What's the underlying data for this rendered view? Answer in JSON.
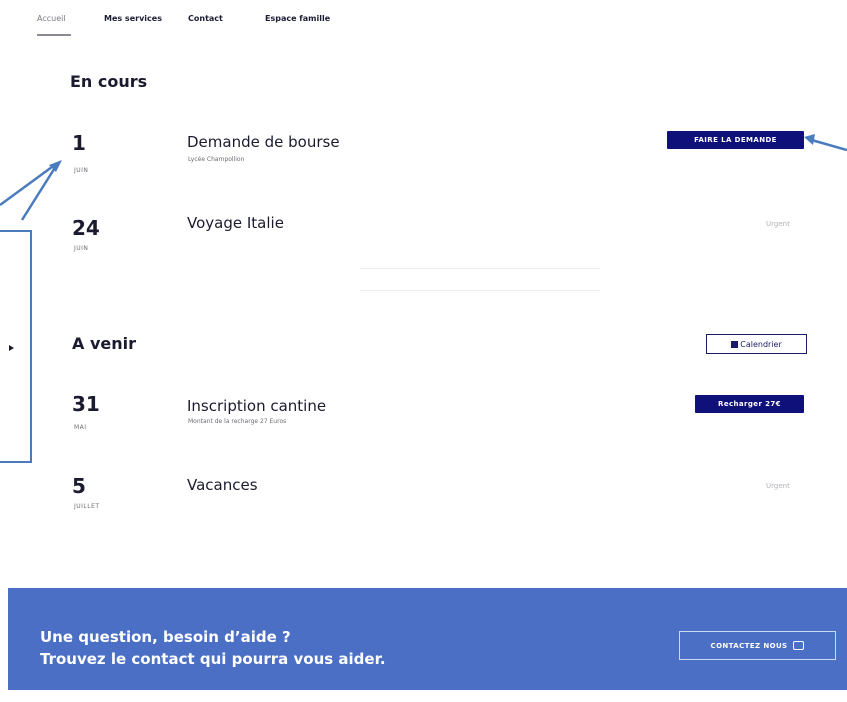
{
  "nav": {
    "items": [
      {
        "label": "Accueil"
      },
      {
        "label": "Mes services"
      },
      {
        "label": "Contact"
      },
      {
        "label": "Espace famille"
      }
    ]
  },
  "en_cours": {
    "title": "En cours",
    "events": [
      {
        "day": "1",
        "month": "JUIN",
        "title": "Demande de bourse",
        "subtitle": "Lycée Champollion",
        "action_label": "FAIRE LA DEMANDE"
      },
      {
        "day": "24",
        "month": "JUIN",
        "title": "Voyage Italie",
        "status": "Urgent"
      }
    ]
  },
  "a_venir": {
    "title": "A venir",
    "calendar_button": "Calendrier",
    "events": [
      {
        "day": "31",
        "month": "MAI",
        "title": "Inscription cantine",
        "subtitle": "Montant de la recharge 27 Euros",
        "action_label": "Recharger 27€"
      },
      {
        "day": "5",
        "month": "JUILLET",
        "title": "Vacances",
        "status": "Urgent"
      }
    ]
  },
  "footer": {
    "line1": "Une question, besoin d’aide ?",
    "line2": "Trouvez le contact qui pourra vous aider.",
    "button_label": "CONTACTEZ NOUS"
  },
  "colors": {
    "primary_button": "#10107a",
    "footer_bg": "#4a6fc4",
    "annotation": "#4a7bbd"
  },
  "icons": {
    "calendar": "calendar-icon",
    "chat": "chat-icon"
  }
}
